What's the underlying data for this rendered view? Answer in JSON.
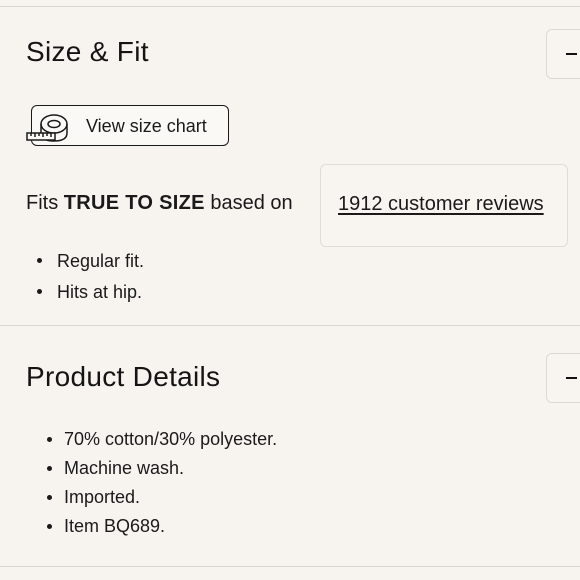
{
  "size_fit": {
    "title": "Size & Fit",
    "toggle_icon": "minus-icon",
    "size_chart_button": {
      "label": "View size chart",
      "icon": "measuring-tape-icon"
    },
    "fits": {
      "prefix": "Fits",
      "emphasis": "TRUE TO SIZE",
      "suffix": "based on"
    },
    "reviews_link": "1912 customer reviews",
    "bullets": [
      "Regular fit.",
      "Hits at hip."
    ]
  },
  "product_details": {
    "title": "Product Details",
    "toggle_icon": "minus-icon",
    "bullets": [
      "70% cotton/30% polyester.",
      "Machine wash.",
      "Imported.",
      "Item BQ689."
    ]
  },
  "colors": {
    "background": "#f7f4f0",
    "text": "#1a1a1a",
    "divider": "#d9d5d0"
  }
}
